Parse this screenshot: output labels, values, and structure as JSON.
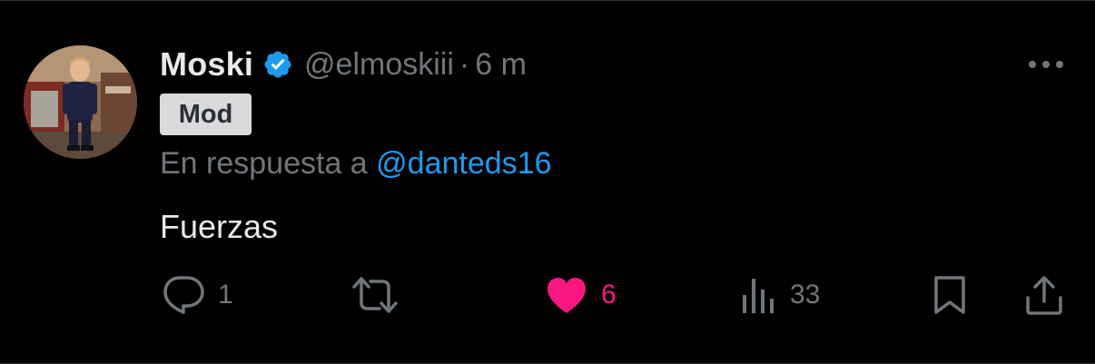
{
  "author": {
    "display_name": "Moski",
    "handle": "@elmoskiii",
    "separator": "·",
    "time": "6 m",
    "verified": true,
    "badge": "Mod"
  },
  "reply": {
    "prefix": "En respuesta a ",
    "mention": "@danteds16"
  },
  "tweet": {
    "text": "Fuerzas"
  },
  "actions": {
    "reply_count": "1",
    "retweet_count": "",
    "like_count": "6",
    "views_count": "33"
  },
  "colors": {
    "background": "#000000",
    "primary_text": "#e7e9ea",
    "secondary_text": "#71767b",
    "link": "#1d9bf0",
    "verified": "#1d9bf0",
    "like": "#f91880",
    "badge_bg": "#d9dadc"
  },
  "icons": {
    "verified": "verified-badge-icon",
    "more": "more-dots-icon",
    "reply": "reply-bubble-icon",
    "retweet": "retweet-icon",
    "like": "heart-filled-icon",
    "views": "views-bar-chart-icon",
    "bookmark": "bookmark-icon",
    "share": "share-upload-icon"
  }
}
